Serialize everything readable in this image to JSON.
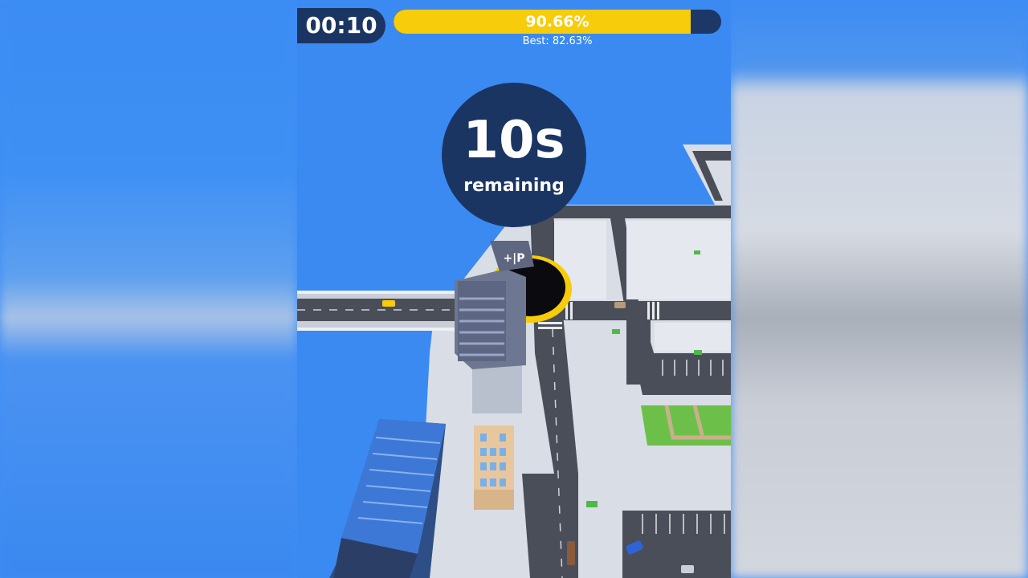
{
  "hud": {
    "timer": "00:10",
    "progress_text": "90.66%",
    "progress_value": 0.9066,
    "best_text": "Best: 82.63%",
    "countdown_number": "10s",
    "countdown_label": "remaining"
  },
  "colors": {
    "hud_dark": "#1b3563",
    "progress_fill": "#f6cc0b",
    "water": "#3a8af2",
    "road": "#4a4e58",
    "pavement": "#d9dde5",
    "grass": "#6cc04a",
    "hole_ring": "#f6cc0b"
  },
  "scene": {
    "buildings": [
      "glass-tower-building",
      "office-tower-being-swallowed",
      "beige-apartment-building"
    ],
    "icons": [
      "black-hole-player",
      "yellow-taxi-car",
      "blue-car",
      "brown-bus",
      "grass-park"
    ]
  }
}
